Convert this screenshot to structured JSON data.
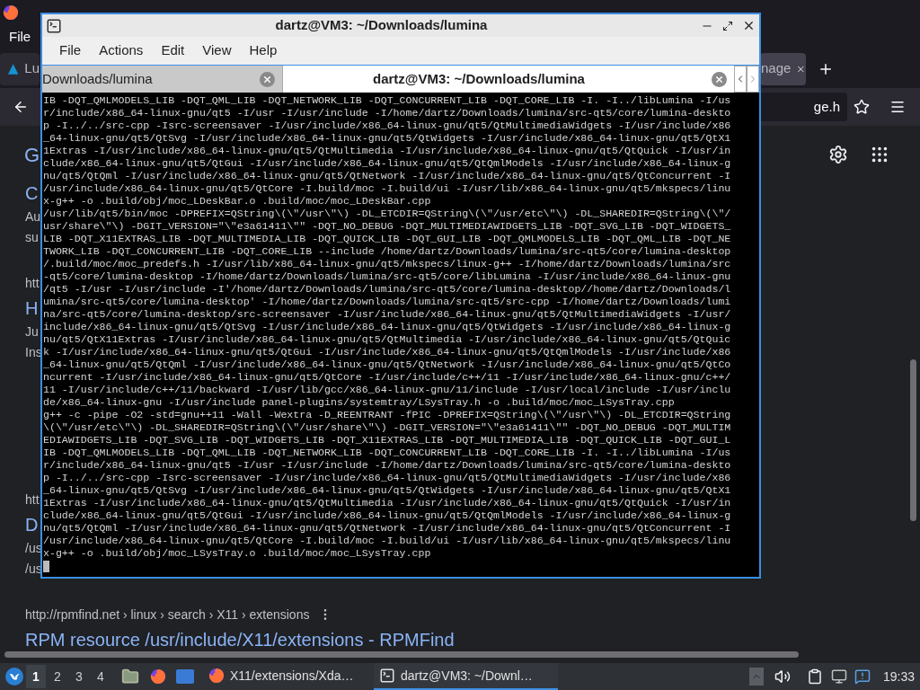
{
  "browser": {
    "menu": [
      {
        "label": "File"
      }
    ],
    "tabs": [
      {
        "label": "Lu",
        "selected": false
      },
      {
        "label": "nage",
        "selected": true
      }
    ],
    "address_fragment": "ge.h",
    "logo_fragment": "G",
    "results": [
      {
        "heading": "C",
        "snippets": [
          "Au",
          "su"
        ]
      },
      {
        "url": "htt",
        "heading": "H",
        "snippets": [
          "Ju",
          "Ins"
        ]
      },
      {
        "url": "htt",
        "heading": "D",
        "snippets": [
          "/us",
          "/us"
        ]
      },
      {
        "url": "http://rpmfind.net › linux › search › X11 › extensions",
        "heading": "RPM resource /usr/include/X11/extensions - RPMFind"
      }
    ]
  },
  "terminal": {
    "title": "dartz@VM3: ~/Downloads/lumina",
    "menu": [
      {
        "label": "File"
      },
      {
        "label": "Actions"
      },
      {
        "label": "Edit"
      },
      {
        "label": "View"
      },
      {
        "label": "Help"
      }
    ],
    "tabs": [
      {
        "label": "Downloads/lumina",
        "selected": false
      },
      {
        "label": "dartz@VM3: ~/Downloads/lumina",
        "selected": true
      }
    ],
    "lines": [
      "IB -DQT_QMLMODELS_LIB -DQT_QML_LIB -DQT_NETWORK_LIB -DQT_CONCURRENT_LIB -DQT_CORE_LIB -I. -I../libLumina -I/us",
      "r/include/x86_64-linux-gnu/qt5 -I/usr -I/usr/include -I/home/dartz/Downloads/lumina/src-qt5/core/lumina-deskto",
      "p -I../../src-cpp -Isrc-screensaver -I/usr/include/x86_64-linux-gnu/qt5/QtMultimediaWidgets -I/usr/include/x86",
      "_64-linux-gnu/qt5/QtSvg -I/usr/include/x86_64-linux-gnu/qt5/QtWidgets -I/usr/include/x86_64-linux-gnu/qt5/QtX1",
      "1Extras -I/usr/include/x86_64-linux-gnu/qt5/QtMultimedia -I/usr/include/x86_64-linux-gnu/qt5/QtQuick -I/usr/in",
      "clude/x86_64-linux-gnu/qt5/QtGui -I/usr/include/x86_64-linux-gnu/qt5/QtQmlModels -I/usr/include/x86_64-linux-g",
      "nu/qt5/QtQml -I/usr/include/x86_64-linux-gnu/qt5/QtNetwork -I/usr/include/x86_64-linux-gnu/qt5/QtConcurrent -I",
      "/usr/include/x86_64-linux-gnu/qt5/QtCore -I.build/moc -I.build/ui -I/usr/lib/x86_64-linux-gnu/qt5/mkspecs/linu",
      "x-g++ -o .build/obj/moc_LDeskBar.o .build/moc/moc_LDeskBar.cpp",
      "/usr/lib/qt5/bin/moc -DPREFIX=QString\\(\\\"/usr\\\"\\) -DL_ETCDIR=QString\\(\\\"/usr/etc\\\"\\) -DL_SHAREDIR=QString\\(\\\"/",
      "usr/share\\\"\\) -DGIT_VERSION=\"\\\"e3a61411\\\"\" -DQT_NO_DEBUG -DQT_MULTIMEDIAWIDGETS_LIB -DQT_SVG_LIB -DQT_WIDGETS_",
      "LIB -DQT_X11EXTRAS_LIB -DQT_MULTIMEDIA_LIB -DQT_QUICK_LIB -DQT_GUI_LIB -DQT_QMLMODELS_LIB -DQT_QML_LIB -DQT_NE",
      "TWORK_LIB -DQT_CONCURRENT_LIB -DQT_CORE_LIB --include /home/dartz/Downloads/lumina/src-qt5/core/lumina-desktop",
      "/.build/moc/moc_predefs.h -I/usr/lib/x86_64-linux-gnu/qt5/mkspecs/linux-g++ -I/home/dartz/Downloads/lumina/src",
      "-qt5/core/lumina-desktop -I/home/dartz/Downloads/lumina/src-qt5/core/libLumina -I/usr/include/x86_64-linux-gnu",
      "/qt5 -I/usr -I/usr/include -I'/home/dartz/Downloads/lumina/src-qt5/core/lumina-desktop//home/dartz/Downloads/l",
      "umina/src-qt5/core/lumina-desktop' -I/home/dartz/Downloads/lumina/src-qt5/src-cpp -I/home/dartz/Downloads/lumi",
      "na/src-qt5/core/lumina-desktop/src-screensaver -I/usr/include/x86_64-linux-gnu/qt5/QtMultimediaWidgets -I/usr/",
      "include/x86_64-linux-gnu/qt5/QtSvg -I/usr/include/x86_64-linux-gnu/qt5/QtWidgets -I/usr/include/x86_64-linux-g",
      "nu/qt5/QtX11Extras -I/usr/include/x86_64-linux-gnu/qt5/QtMultimedia -I/usr/include/x86_64-linux-gnu/qt5/QtQuic",
      "k -I/usr/include/x86_64-linux-gnu/qt5/QtGui -I/usr/include/x86_64-linux-gnu/qt5/QtQmlModels -I/usr/include/x86",
      "_64-linux-gnu/qt5/QtQml -I/usr/include/x86_64-linux-gnu/qt5/QtNetwork -I/usr/include/x86_64-linux-gnu/qt5/QtCo",
      "ncurrent -I/usr/include/x86_64-linux-gnu/qt5/QtCore -I/usr/include/c++/11 -I/usr/include/x86_64-linux-gnu/c++/",
      "11 -I/usr/include/c++/11/backward -I/usr/lib/gcc/x86_64-linux-gnu/11/include -I/usr/local/include -I/usr/inclu",
      "de/x86_64-linux-gnu -I/usr/include panel-plugins/systemtray/LSysTray.h -o .build/moc/moc_LSysTray.cpp",
      "g++ -c -pipe -O2 -std=gnu++11 -Wall -Wextra -D_REENTRANT -fPIC -DPREFIX=QString\\(\\\"/usr\\\"\\) -DL_ETCDIR=QString",
      "\\(\\\"/usr/etc\\\"\\) -DL_SHAREDIR=QString\\(\\\"/usr/share\\\"\\) -DGIT_VERSION=\"\\\"e3a61411\\\"\" -DQT_NO_DEBUG -DQT_MULTIM",
      "EDIAWIDGETS_LIB -DQT_SVG_LIB -DQT_WIDGETS_LIB -DQT_X11EXTRAS_LIB -DQT_MULTIMEDIA_LIB -DQT_QUICK_LIB -DQT_GUI_L",
      "IB -DQT_QMLMODELS_LIB -DQT_QML_LIB -DQT_NETWORK_LIB -DQT_CONCURRENT_LIB -DQT_CORE_LIB -I. -I../libLumina -I/us",
      "r/include/x86_64-linux-gnu/qt5 -I/usr -I/usr/include -I/home/dartz/Downloads/lumina/src-qt5/core/lumina-deskto",
      "p -I../../src-cpp -Isrc-screensaver -I/usr/include/x86_64-linux-gnu/qt5/QtMultimediaWidgets -I/usr/include/x86",
      "_64-linux-gnu/qt5/QtSvg -I/usr/include/x86_64-linux-gnu/qt5/QtWidgets -I/usr/include/x86_64-linux-gnu/qt5/QtX1",
      "1Extras -I/usr/include/x86_64-linux-gnu/qt5/QtMultimedia -I/usr/include/x86_64-linux-gnu/qt5/QtQuick -I/usr/in",
      "clude/x86_64-linux-gnu/qt5/QtGui -I/usr/include/x86_64-linux-gnu/qt5/QtQmlModels -I/usr/include/x86_64-linux-g",
      "nu/qt5/QtQml -I/usr/include/x86_64-linux-gnu/qt5/QtNetwork -I/usr/include/x86_64-linux-gnu/qt5/QtConcurrent -I",
      "/usr/include/x86_64-linux-gnu/qt5/QtCore -I.build/moc -I.build/ui -I/usr/lib/x86_64-linux-gnu/qt5/mkspecs/linu",
      "x-g++ -o .build/obj/moc_LSysTray.o .build/moc/moc_LSysTray.cpp"
    ]
  },
  "taskbar": {
    "workspaces": [
      {
        "label": "1",
        "selected": true
      },
      {
        "label": "2",
        "selected": false
      },
      {
        "label": "3",
        "selected": false
      },
      {
        "label": "4",
        "selected": false
      }
    ],
    "tasks": [
      {
        "kind": "browser",
        "label": "X11/extensions/Xda…",
        "selected": false
      },
      {
        "kind": "terminal",
        "label": "dartz@VM3: ~/Downl…",
        "selected": true
      }
    ],
    "clock": "19:33"
  }
}
